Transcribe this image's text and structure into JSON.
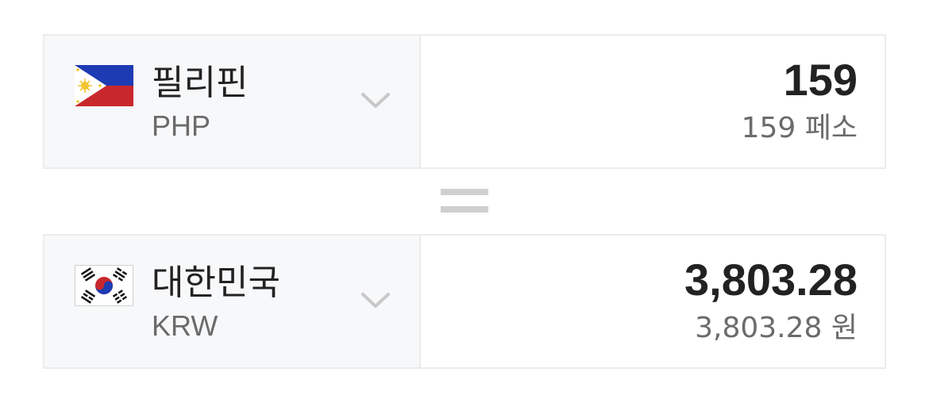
{
  "converter": {
    "from": {
      "country": "필리핀",
      "code": "PHP",
      "amount": "159",
      "amount_text": "159 페소",
      "flag_icon": "philippines-flag-icon"
    },
    "equals_icon": "equals-icon",
    "to": {
      "country": "대한민국",
      "code": "KRW",
      "amount": "3,803.28",
      "amount_text": "3,803.28 원",
      "flag_icon": "south-korea-flag-icon"
    }
  },
  "colors": {
    "card_left_bg": "#f7f8fa",
    "border": "#ececec",
    "amount_text": "#222222",
    "secondary_text": "#6b6b6b",
    "chevron": "#c8c8c8",
    "equals": "#cfcfcf"
  }
}
